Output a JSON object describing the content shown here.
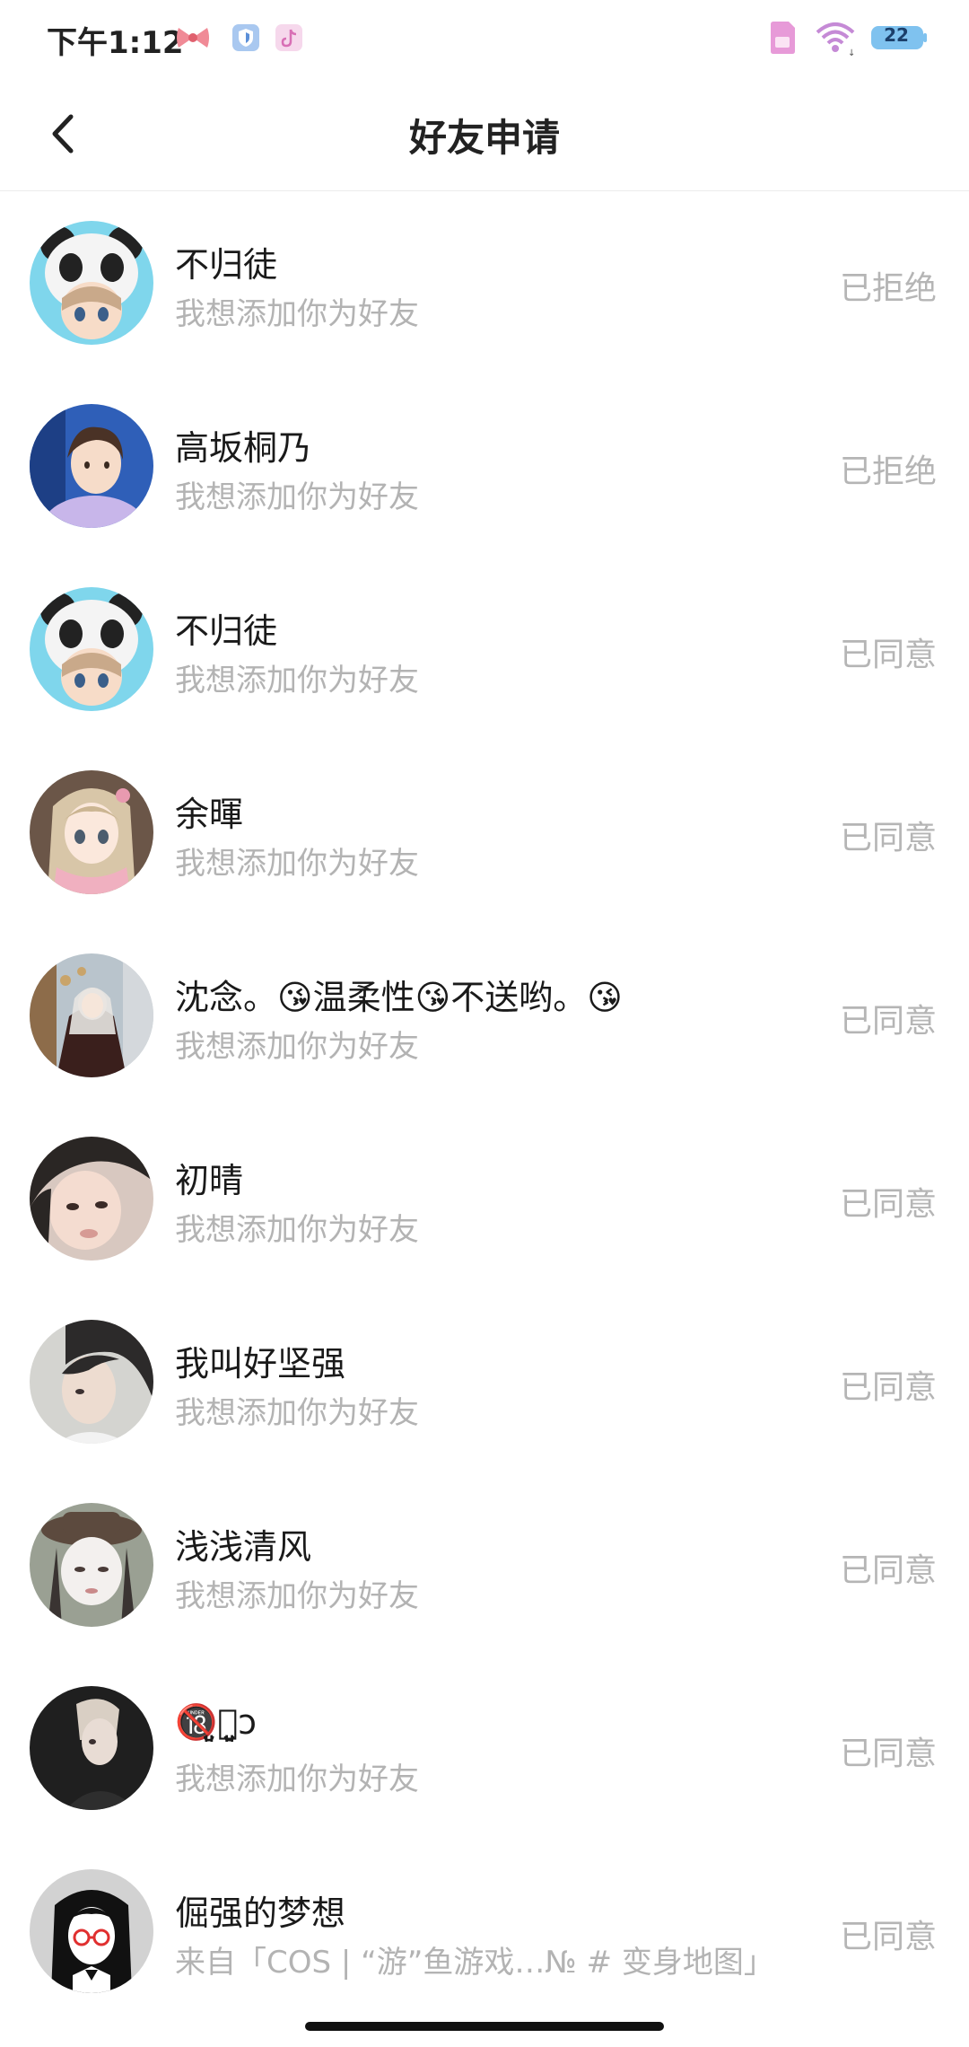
{
  "status_bar": {
    "time": "下午1:12",
    "battery": "22"
  },
  "header": {
    "title": "好友申请"
  },
  "requests": [
    {
      "name": "不归徒",
      "message": "我想添加你为好友",
      "status": "已拒绝",
      "avatar": "panda-hood-girl-avatar"
    },
    {
      "name": "高坂桐乃",
      "message": "我想添加你为好友",
      "status": "已拒绝",
      "avatar": "anime-boy-avatar"
    },
    {
      "name": "不归徒",
      "message": "我想添加你为好友",
      "status": "已同意",
      "avatar": "panda-hood-girl-avatar"
    },
    {
      "name": "余暉",
      "message": "我想添加你为好友",
      "status": "已同意",
      "avatar": "anime-girl-scarf-avatar"
    },
    {
      "name": "沈念。😘温柔性😘不送哟。😘",
      "message": "我想添加你为好友",
      "status": "已同意",
      "avatar": "anime-fantasy-avatar"
    },
    {
      "name": "初晴",
      "message": "我想添加你为好友",
      "status": "已同意",
      "avatar": "girl-photo-avatar"
    },
    {
      "name": "我叫好坚强",
      "message": "我想添加你为好友",
      "status": "已同意",
      "avatar": "boy-photo-avatar"
    },
    {
      "name": "浅浅清风",
      "message": "我想添加你为好友",
      "status": "已同意",
      "avatar": "hat-girl-photo-avatar"
    },
    {
      "name": "🔞͈̮忆͈̮ↄ",
      "message": "我想添加你为好友",
      "status": "已同意",
      "avatar": "dark-boy-photo-avatar"
    },
    {
      "name": "倔强的梦想",
      "message": "来自「COS | “游”鱼游戏…№ # 变身地图」",
      "status": "已同意",
      "avatar": "glasses-girl-drawing-avatar"
    }
  ],
  "colors": {
    "background": "#ffffff",
    "primary_text": "#1a1a1a",
    "secondary_text": "#b3b3b3",
    "status_text": "#b5b5b5",
    "battery": "#3a8ee6"
  }
}
